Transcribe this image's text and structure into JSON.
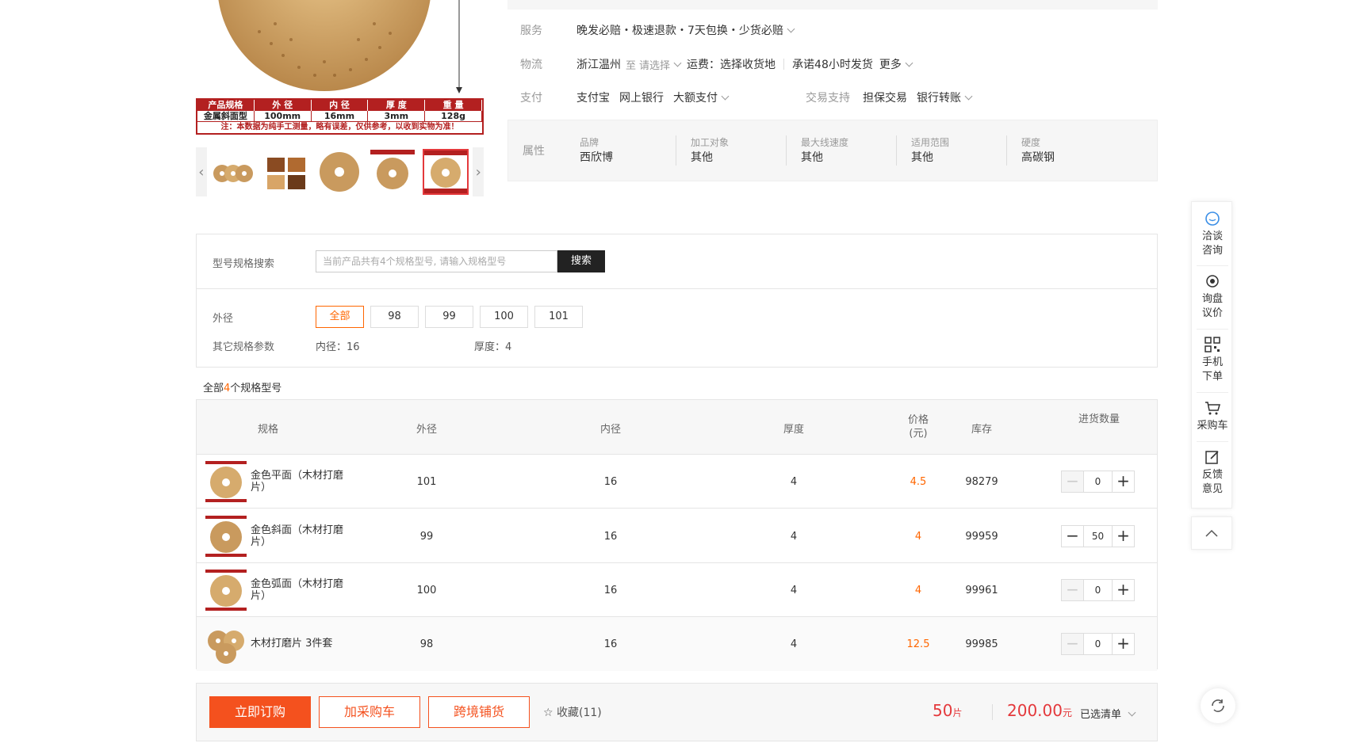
{
  "gallery": {
    "spec_table": {
      "headers": [
        "产品规格",
        "外 径",
        "内 径",
        "厚 度",
        "重 量"
      ],
      "values": [
        "金属斜面型",
        "100mm",
        "16mm",
        "3mm",
        "128g"
      ],
      "note": "注：本数据为纯手工测量，略有误差，仅供参考，以收到实物为准！"
    }
  },
  "service": {
    "service_label": "服务",
    "service_text": "晚发必赔・极速退款・7天包换・少货必赔",
    "logistics_label": "物流",
    "origin": "浙江温州",
    "to": "至",
    "select_placeholder": "请选择",
    "freight": "运费：选择收货地",
    "promise": "承诺48小时发货",
    "more": "更多",
    "payment_label": "支付",
    "payments": [
      "支付宝",
      "网上银行",
      "大额支付"
    ],
    "trade_label": "交易支持",
    "trade_items": [
      "担保交易",
      "银行转账"
    ]
  },
  "attributes": {
    "label": "属性",
    "items": [
      {
        "key": "品牌",
        "value": "西欣博"
      },
      {
        "key": "加工对象",
        "value": "其他"
      },
      {
        "key": "最大线速度",
        "value": "其他"
      },
      {
        "key": "适用范围",
        "value": "其他"
      },
      {
        "key": "硬度",
        "value": "高碳钢"
      }
    ]
  },
  "filters": {
    "search_label": "型号规格搜索",
    "search_placeholder": "当前产品共有4个规格型号, 请输入规格型号",
    "search_button": "搜索",
    "diameter_label": "外径",
    "diameter_options": [
      "全部",
      "98",
      "99",
      "100",
      "101"
    ],
    "other_label": "其它规格参数",
    "inner_diameter": "内径：16",
    "thickness": "厚度：4"
  },
  "count": {
    "prefix": "全部",
    "num": "4",
    "suffix": "个规格型号"
  },
  "table": {
    "headers": {
      "spec": "规格",
      "outer": "外径",
      "inner": "内径",
      "thick": "厚度",
      "price_1": "价格",
      "price_2": "(元)",
      "stock": "库存",
      "qty": "进货数量"
    },
    "rows": [
      {
        "name": "金色平面（木材打磨片）",
        "outer": "101",
        "inner": "16",
        "thick": "4",
        "price": "4.5",
        "stock": "98279",
        "qty": "0"
      },
      {
        "name": "金色斜面（木材打磨片）",
        "outer": "99",
        "inner": "16",
        "thick": "4",
        "price": "4",
        "stock": "99959",
        "qty": "50"
      },
      {
        "name": "金色弧面（木材打磨片）",
        "outer": "100",
        "inner": "16",
        "thick": "4",
        "price": "4",
        "stock": "99961",
        "qty": "0"
      },
      {
        "name": "木材打磨片 3件套",
        "outer": "98",
        "inner": "16",
        "thick": "4",
        "price": "12.5",
        "stock": "99985",
        "qty": "0"
      }
    ]
  },
  "bottom": {
    "order_now": "立即订购",
    "add_cart": "加采购车",
    "cross_border": "跨境铺货",
    "favorite": "收藏(11)",
    "total_qty": "50",
    "qty_unit": "片",
    "total_amount": "200.00",
    "amount_unit": "元",
    "selected_list": "已选清单"
  },
  "sidebar": {
    "consult": "洽谈咨询",
    "inquiry": "询盘议价",
    "mobile": "手机下单",
    "cart": "采购车",
    "feedback": "反馈意见"
  },
  "colors": {
    "accent": "#f4511e",
    "price": "#ff6600",
    "total": "#e4393c"
  }
}
